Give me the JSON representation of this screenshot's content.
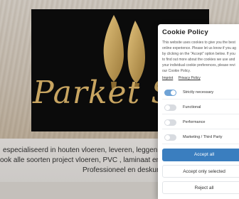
{
  "page": {
    "logo_text": "Parket S",
    "intro_line1": "especialiseerd in houten vloeren, leveren, leggen, schuren, onde",
    "intro_line2": "ook alle soorten project vloeren, PVC , laminaat en trap renova",
    "intro_line3": "Professioneel en deskundig"
  },
  "cookie": {
    "title": "Cookie Policy",
    "description": [
      "This website uses cookies to give you the best",
      "online experience. Please let us know if you ag",
      "by clicking on the \"Accept\" option below. If you",
      "to find out more about the cookies we use and",
      "your individual cookie preferences, please revi",
      "our Cookie Policy."
    ],
    "imprint": "Imprint",
    "privacy": "Privacy Policy",
    "categories": [
      {
        "label": "Strictly necessary",
        "enabled": true
      },
      {
        "label": "Functional",
        "enabled": false
      },
      {
        "label": "Performance",
        "enabled": false
      },
      {
        "label": "Marketing / Third Party",
        "enabled": false
      }
    ],
    "accept_all": "Accept all",
    "accept_selected": "Accept only selected",
    "reject_all": "Reject all"
  },
  "colors": {
    "accent": "#3a7ebf",
    "gold": "#c8a561"
  }
}
